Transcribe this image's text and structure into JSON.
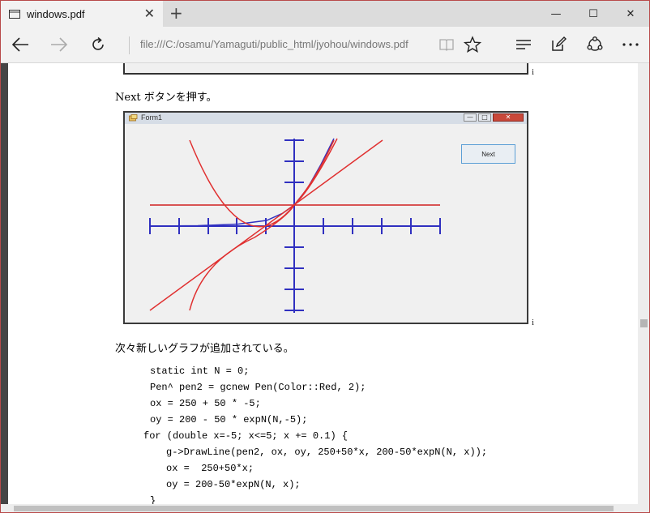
{
  "tab": {
    "title": "windows.pdf",
    "close": "✕"
  },
  "newtab": "+",
  "window_controls": {
    "minimize": "—",
    "maximize": "☐",
    "close": "✕"
  },
  "address": {
    "url": "file:///C:/osamu/Yamaguti/public_html/jyohou/windows.pdf"
  },
  "doc": {
    "marker1": "i",
    "para1": "Next ボタンを押す。",
    "figure": {
      "form_title": "Form1",
      "next_button": "Next",
      "ctrl_min": "—",
      "ctrl_max": "□",
      "ctrl_close": "✕"
    },
    "marker2": "i",
    "para2": "次々新しいグラフが追加されている。",
    "code": [
      "static int N = 0;",
      "Pen^ pen2 = gcnew Pen(Color::Red, 2);",
      "ox = 250 + 50 * -5;",
      "oy = 200 - 50 * expN(N,-5);",
      "for (double x=-5; x<=5; x += 0.1) {",
      "g->DrawLine(pen2, ox, oy, 250+50*x, 200-50*expN(N, x));",
      "ox =  250+50*x;",
      "oy = 200-50*expN(N, x);",
      "}"
    ]
  },
  "colors": {
    "axis": "#3030c0",
    "curve": "#e03030",
    "accent": "#b84a4a"
  }
}
